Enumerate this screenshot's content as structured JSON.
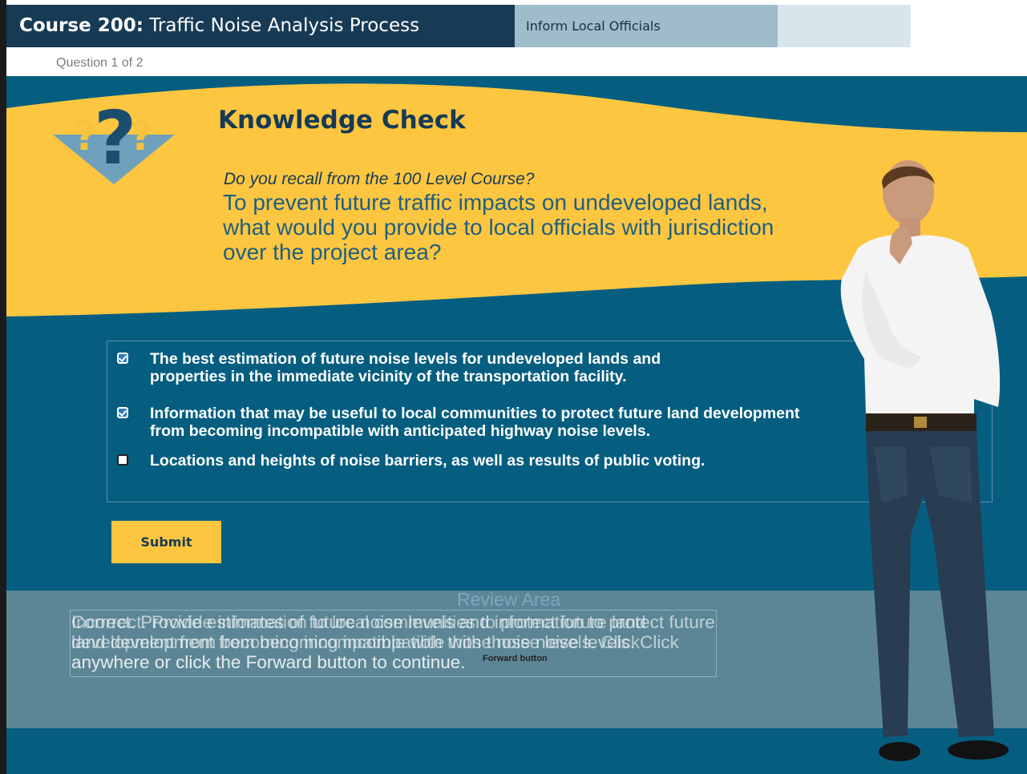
{
  "header": {
    "course_bold": "Course 200:",
    "course_title": "Traffic Noise Analysis Process",
    "active_tab": "Inform Local Officials"
  },
  "progress": {
    "label": "Question 1 of 2"
  },
  "knowledge_check": {
    "title": "Knowledge Check",
    "recall": "Do you recall from the 100 Level Course?",
    "question": "To prevent future traffic impacts on undeveloped lands, what would you provide to local officials with jurisdiction over the project area?",
    "options": [
      {
        "text": "The best estimation of future noise levels for undeveloped lands and properties in the immediate vicinity of the transportation facility.",
        "checked": true
      },
      {
        "text": "Information that may be useful to local communities to protect future land development from becoming incompatible with anticipated highway noise levels.",
        "checked": true
      },
      {
        "text": "Locations and heights of noise barriers, as well as results of public voting.",
        "checked": false
      }
    ],
    "submit_label": "Submit"
  },
  "review": {
    "label": "Review Area",
    "feedback_correct": "Correct. Provide estimates of future noise levels and information to protect future land development from becoming incompatible with those noise levels. Click anywhere or click the Forward button to continue.",
    "feedback_incorrect": "Incorrect. Provide information to local communities to protect future land development from becoming incompatible with those noise levels. Click anywhere or click the Forward button to continue.",
    "small_caption": "Forward button"
  },
  "colors": {
    "navy": "#173a55",
    "teal": "#055e80",
    "yellow": "#fdc640",
    "review_band": "#5c8696"
  },
  "icons": [
    "question-marks-icon",
    "checkbox-checked-icon",
    "checkbox-unchecked-icon"
  ]
}
